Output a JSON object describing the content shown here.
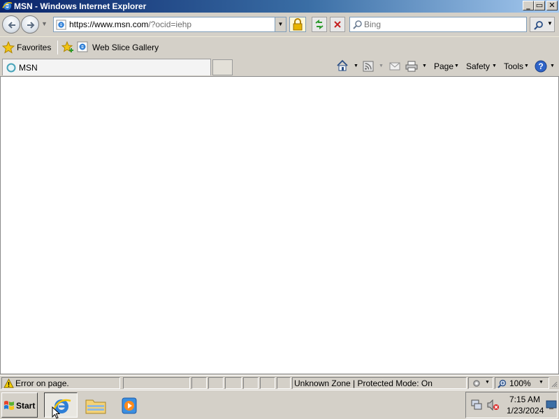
{
  "window": {
    "title": "MSN - Windows Internet Explorer",
    "controls": {
      "minimize": "_",
      "maximize": "▭",
      "close": "✕"
    }
  },
  "address_bar": {
    "url_scheme": "https://",
    "url_domain": "www.msn.com",
    "url_rest": "/?ocid=iehp"
  },
  "search": {
    "placeholder": "Bing"
  },
  "favorites_bar": {
    "favorites_label": "Favorites",
    "web_slice_label": "Web Slice Gallery"
  },
  "tabs": [
    {
      "label": "MSN"
    }
  ],
  "command_bar": {
    "page_label": "Page",
    "safety_label": "Safety",
    "tools_label": "Tools"
  },
  "status_bar": {
    "error_text": "Error on page.",
    "zone_text": "Unknown Zone | Protected Mode: On",
    "zoom": "100%"
  },
  "taskbar": {
    "start_label": "Start",
    "time": "7:15 AM",
    "date": "1/23/2024"
  },
  "colors": {
    "chrome": "#d4d0c8",
    "title_gradient_start": "#0a246a",
    "title_gradient_end": "#a6caf0"
  }
}
